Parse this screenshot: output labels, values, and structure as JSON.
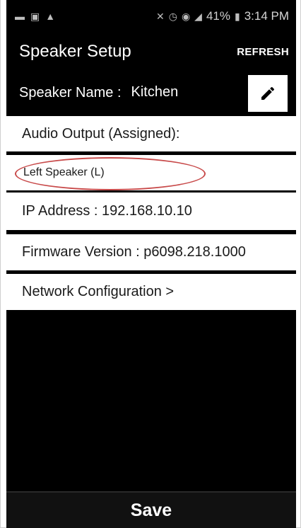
{
  "status_bar": {
    "battery": "41%",
    "time": "3:14 PM"
  },
  "app_bar": {
    "title": "Speaker Setup",
    "refresh_label": "REFRESH"
  },
  "speaker_name": {
    "label": "Speaker Name :",
    "value": "Kitchen"
  },
  "rows": {
    "audio_output_label": "Audio Output (Assigned):",
    "assigned_speaker": "Left Speaker (L)",
    "ip_address": "IP  Address : 192.168.10.10",
    "firmware_version": "Firmware  Version : p6098.218.1000",
    "network_configuration": "Network  Configuration >"
  },
  "save": {
    "label": "Save"
  },
  "colors": {
    "background": "#000000",
    "row_background": "#ffffff",
    "highlight_ellipse": "#c84a4a"
  }
}
